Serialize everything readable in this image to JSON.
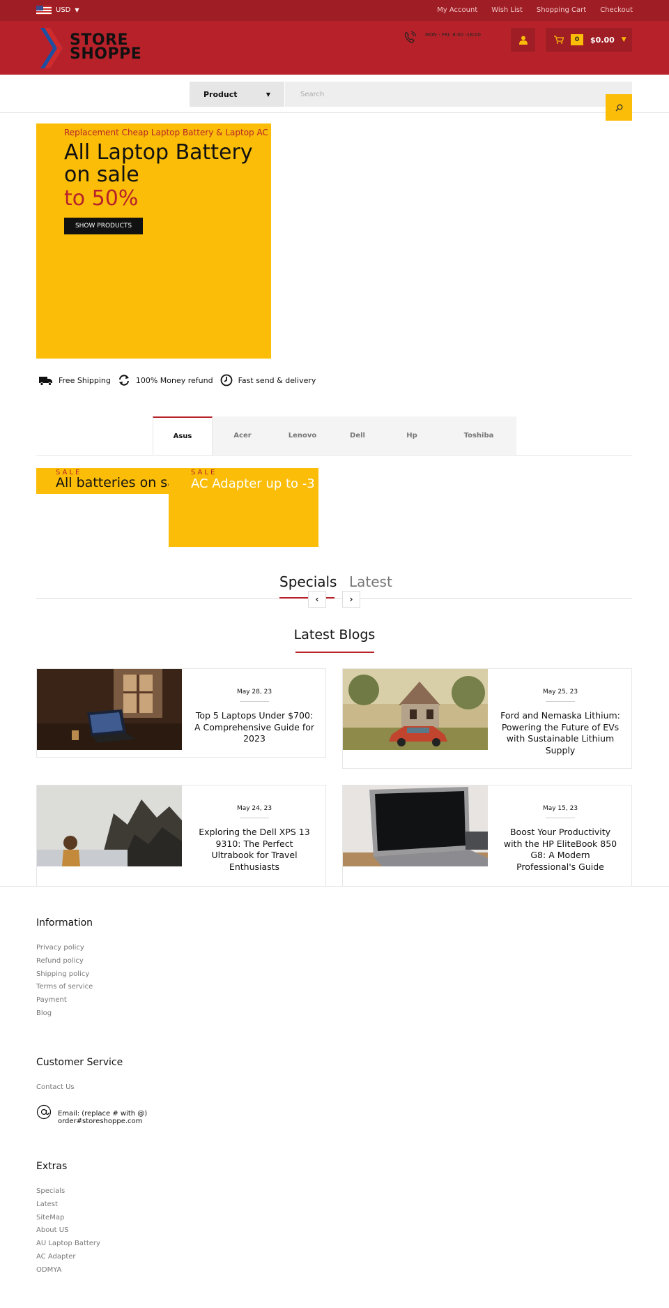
{
  "topbar": {
    "currency": "USD",
    "links": [
      "My Account",
      "Wish List",
      "Shopping Cart",
      "Checkout"
    ]
  },
  "header": {
    "logo_line1": "STORE",
    "logo_line2": "SHOPPE",
    "hours": "MON - FRI: 8:00 -18:00",
    "cart_count": "0",
    "cart_total": "$0.00"
  },
  "search": {
    "category": "Product",
    "placeholder": "Search"
  },
  "hero": {
    "subtitle": "Replacement Cheap Laptop Battery & Laptop AC A",
    "title_line1": "All Laptop Battery",
    "title_line2": "on sale",
    "accent": "to 50%",
    "button": "SHOW PRODUCTS"
  },
  "features": [
    "Free Shipping",
    "100% Money refund",
    "Fast send & delivery"
  ],
  "brands": [
    "Asus",
    "Acer",
    "Lenovo",
    "Dell",
    "Hp",
    "Toshiba"
  ],
  "banners": [
    {
      "tag": "SALE",
      "text": "All batteries on sa"
    },
    {
      "tag": "SALE",
      "text": "AC Adapter up to -3"
    }
  ],
  "product_tabs": [
    "Specials",
    "Latest"
  ],
  "blogs": {
    "heading": "Latest Blogs",
    "posts": [
      {
        "date": "May 28, 23",
        "title": "Top 5 Laptops Under $700: A Comprehensive Guide for 2023"
      },
      {
        "date": "May 25, 23",
        "title": "Ford and Nemaska Lithium: Powering the Future of EVs with Sustainable Lithium Supply"
      },
      {
        "date": "May 24, 23",
        "title": "Exploring the Dell XPS 13 9310: The Perfect Ultrabook for Travel Enthusiasts"
      },
      {
        "date": "May 15, 23",
        "title": "Boost Your Productivity with the HP EliteBook 850 G8: A Modern Professional's Guide"
      }
    ]
  },
  "footer": {
    "information": {
      "heading": "Information",
      "links": [
        "Privacy policy",
        "Refund policy",
        "Shipping policy",
        "Terms of service",
        "Payment",
        "Blog"
      ]
    },
    "customer_service": {
      "heading": "Customer Service",
      "links": [
        "Contact Us"
      ],
      "email_line1": "Email: (replace # with @)",
      "email_line2": "order#storeshoppe.com"
    },
    "extras": {
      "heading": "Extras",
      "links": [
        "Specials",
        "Latest",
        "SiteMap",
        "About US",
        "AU Laptop Battery",
        "AC Adapter",
        "ODMYA"
      ]
    }
  },
  "colors": {
    "brand_red": "#b7222a",
    "dark_red": "#9f1d24",
    "accent_yellow": "#fbbd08"
  }
}
